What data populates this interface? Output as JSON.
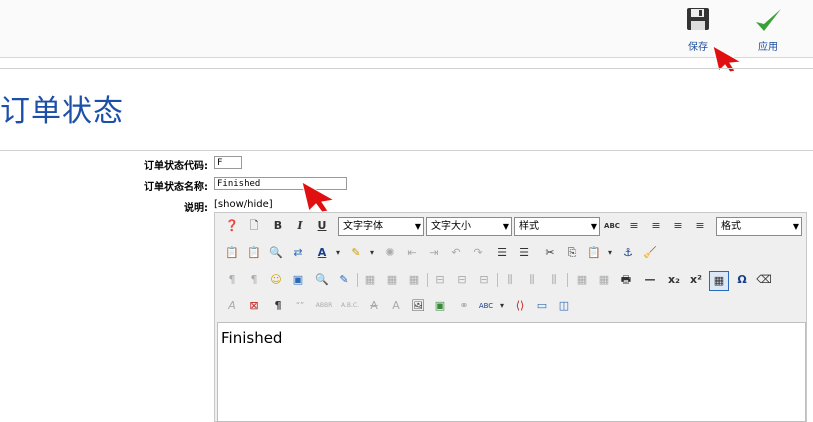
{
  "toolbar": {
    "save_label": "保存",
    "apply_label": "应用"
  },
  "page": {
    "title": "订单状态"
  },
  "form": {
    "code_label": "订单状态代码:",
    "code_value": "F",
    "name_label": "订单状态名称:",
    "name_value": "Finished",
    "desc_label": "说明:",
    "show_hide": "[show/hide]"
  },
  "editor": {
    "font_family": "文字字体",
    "font_size": "文字大小",
    "style": "样式",
    "format": "格式",
    "content": "Finished"
  },
  "colors": {
    "title": "#1b4fa8",
    "apply_check": "#3aa03a",
    "cursor": "#e01010"
  }
}
